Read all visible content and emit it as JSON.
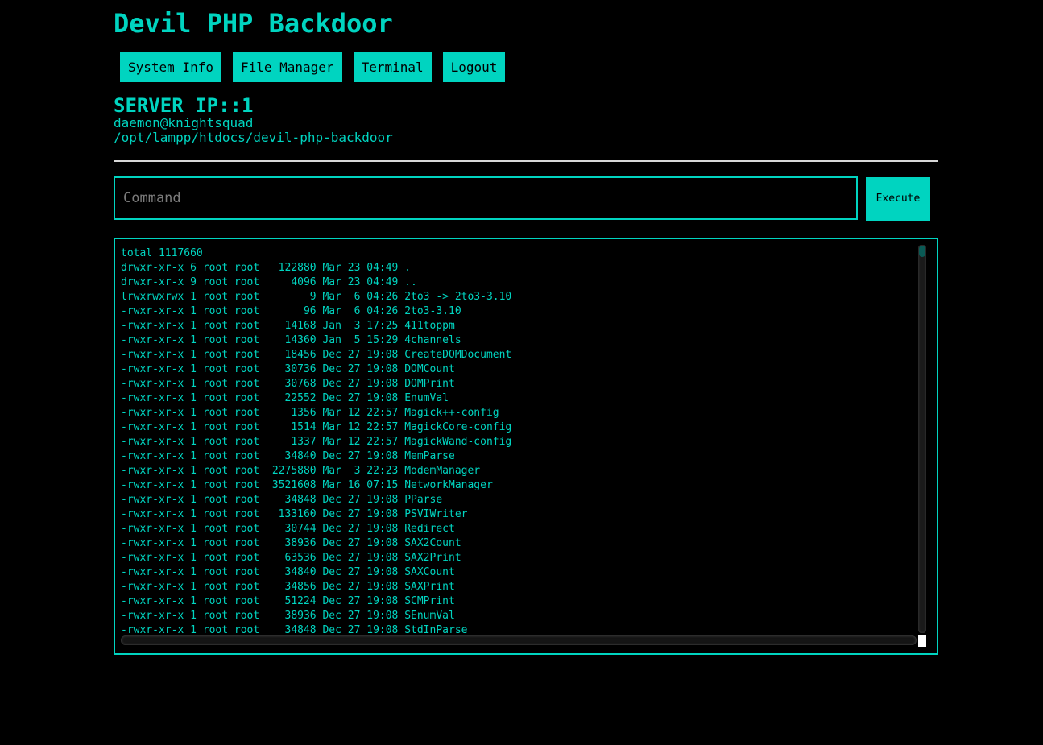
{
  "app": {
    "title": "Devil PHP Backdoor"
  },
  "nav": {
    "items": [
      "System Info",
      "File Manager",
      "Terminal",
      "Logout"
    ]
  },
  "server": {
    "ip_label": "SERVER IP::1",
    "user": "daemon@knightsquad",
    "path": "/opt/lampp/htdocs/devil-php-backdoor"
  },
  "command": {
    "value": "",
    "placeholder": "Command",
    "execute_label": "Execute"
  },
  "output": {
    "lines": [
      "total 1117660",
      "drwxr-xr-x 6 root root   122880 Mar 23 04:49 .",
      "drwxr-xr-x 9 root root     4096 Mar 23 04:49 ..",
      "lrwxrwxrwx 1 root root        9 Mar  6 04:26 2to3 -> 2to3-3.10",
      "-rwxr-xr-x 1 root root       96 Mar  6 04:26 2to3-3.10",
      "-rwxr-xr-x 1 root root    14168 Jan  3 17:25 411toppm",
      "-rwxr-xr-x 1 root root    14360 Jan  5 15:29 4channels",
      "-rwxr-xr-x 1 root root    18456 Dec 27 19:08 CreateDOMDocument",
      "-rwxr-xr-x 1 root root    30736 Dec 27 19:08 DOMCount",
      "-rwxr-xr-x 1 root root    30768 Dec 27 19:08 DOMPrint",
      "-rwxr-xr-x 1 root root    22552 Dec 27 19:08 EnumVal",
      "-rwxr-xr-x 1 root root     1356 Mar 12 22:57 Magick++-config",
      "-rwxr-xr-x 1 root root     1514 Mar 12 22:57 MagickCore-config",
      "-rwxr-xr-x 1 root root     1337 Mar 12 22:57 MagickWand-config",
      "-rwxr-xr-x 1 root root    34840 Dec 27 19:08 MemParse",
      "-rwxr-xr-x 1 root root  2275880 Mar  3 22:23 ModemManager",
      "-rwxr-xr-x 1 root root  3521608 Mar 16 07:15 NetworkManager",
      "-rwxr-xr-x 1 root root    34848 Dec 27 19:08 PParse",
      "-rwxr-xr-x 1 root root   133160 Dec 27 19:08 PSVIWriter",
      "-rwxr-xr-x 1 root root    30744 Dec 27 19:08 Redirect",
      "-rwxr-xr-x 1 root root    38936 Dec 27 19:08 SAX2Count",
      "-rwxr-xr-x 1 root root    63536 Dec 27 19:08 SAX2Print",
      "-rwxr-xr-x 1 root root    34840 Dec 27 19:08 SAXCount",
      "-rwxr-xr-x 1 root root    34856 Dec 27 19:08 SAXPrint",
      "-rwxr-xr-x 1 root root    51224 Dec 27 19:08 SCMPrint",
      "-rwxr-xr-x 1 root root    38936 Dec 27 19:08 SEnumVal",
      "-rwxr-xr-x 1 root root    34848 Dec 27 19:08 StdInParse"
    ]
  },
  "colors": {
    "accent": "#00d4c0",
    "background": "#000000",
    "divider": "#d8d8d8"
  }
}
